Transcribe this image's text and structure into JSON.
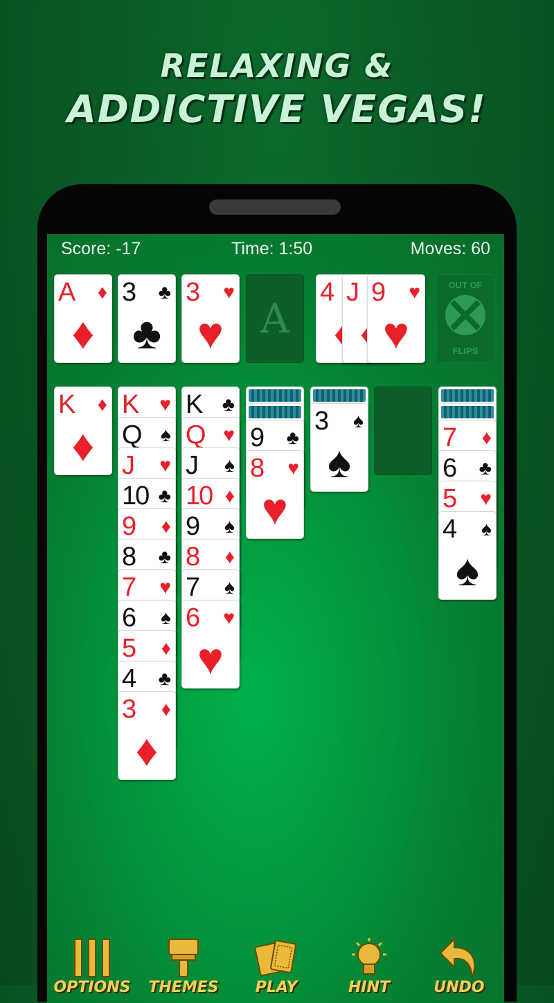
{
  "headline": {
    "line1": "RELAXING &",
    "line2": "ADDICTIVE VEGAS!"
  },
  "hud": {
    "score": "Score: -17",
    "time": "Time: 1:50",
    "moves": "Moves: 60"
  },
  "foundations": [
    {
      "rank": "A",
      "suit": "♦",
      "color": "red"
    },
    {
      "rank": "3",
      "suit": "♣",
      "color": "black"
    },
    {
      "rank": "3",
      "suit": "♥",
      "color": "red"
    },
    {
      "empty_label": "A"
    }
  ],
  "waste": [
    {
      "rank": "4",
      "suit": "♦",
      "color": "red"
    },
    {
      "rank": "J",
      "suit": "♦",
      "color": "red"
    },
    {
      "rank": "9",
      "suit": "♥",
      "color": "red"
    }
  ],
  "stock": {
    "line1": "OUT OF",
    "line2": "FLIPS"
  },
  "tableau": [
    {
      "hidden": 0,
      "cards": [
        {
          "rank": "K",
          "suit": "♦",
          "color": "red"
        }
      ]
    },
    {
      "hidden": 0,
      "cards": [
        {
          "rank": "K",
          "suit": "♥",
          "color": "red"
        },
        {
          "rank": "Q",
          "suit": "♠",
          "color": "black"
        },
        {
          "rank": "J",
          "suit": "♥",
          "color": "red"
        },
        {
          "rank": "10",
          "suit": "♣",
          "color": "black"
        },
        {
          "rank": "9",
          "suit": "♦",
          "color": "red"
        },
        {
          "rank": "8",
          "suit": "♣",
          "color": "black"
        },
        {
          "rank": "7",
          "suit": "♥",
          "color": "red"
        },
        {
          "rank": "6",
          "suit": "♠",
          "color": "black"
        },
        {
          "rank": "5",
          "suit": "♦",
          "color": "red"
        },
        {
          "rank": "4",
          "suit": "♣",
          "color": "black"
        },
        {
          "rank": "3",
          "suit": "♦",
          "color": "red"
        }
      ]
    },
    {
      "hidden": 0,
      "cards": [
        {
          "rank": "K",
          "suit": "♣",
          "color": "black"
        },
        {
          "rank": "Q",
          "suit": "♥",
          "color": "red"
        },
        {
          "rank": "J",
          "suit": "♠",
          "color": "black"
        },
        {
          "rank": "10",
          "suit": "♦",
          "color": "red"
        },
        {
          "rank": "9",
          "suit": "♠",
          "color": "black"
        },
        {
          "rank": "8",
          "suit": "♦",
          "color": "red"
        },
        {
          "rank": "7",
          "suit": "♠",
          "color": "black"
        },
        {
          "rank": "6",
          "suit": "♥",
          "color": "red"
        }
      ]
    },
    {
      "hidden": 2,
      "cards": [
        {
          "rank": "9",
          "suit": "♣",
          "color": "black"
        },
        {
          "rank": "8",
          "suit": "♥",
          "color": "red"
        }
      ]
    },
    {
      "hidden": 1,
      "cards": [
        {
          "rank": "3",
          "suit": "♠",
          "color": "black"
        }
      ]
    },
    {
      "hidden": 0,
      "cards": []
    },
    {
      "hidden": 2,
      "cards": [
        {
          "rank": "7",
          "suit": "♦",
          "color": "red"
        },
        {
          "rank": "6",
          "suit": "♣",
          "color": "black"
        },
        {
          "rank": "5",
          "suit": "♥",
          "color": "red"
        },
        {
          "rank": "4",
          "suit": "♠",
          "color": "black"
        }
      ]
    }
  ],
  "toolbar": [
    {
      "label": "OPTIONS",
      "icon": "options-icon"
    },
    {
      "label": "THEMES",
      "icon": "themes-brush-icon"
    },
    {
      "label": "PLAY",
      "icon": "play-cards-icon"
    },
    {
      "label": "HINT",
      "icon": "hint-lightbulb-icon"
    },
    {
      "label": "UNDO",
      "icon": "undo-arrow-icon"
    }
  ],
  "colors": {
    "red": "#e8202a",
    "black": "#111111",
    "gold": "#f1cf5a",
    "felt": "#03963c"
  }
}
